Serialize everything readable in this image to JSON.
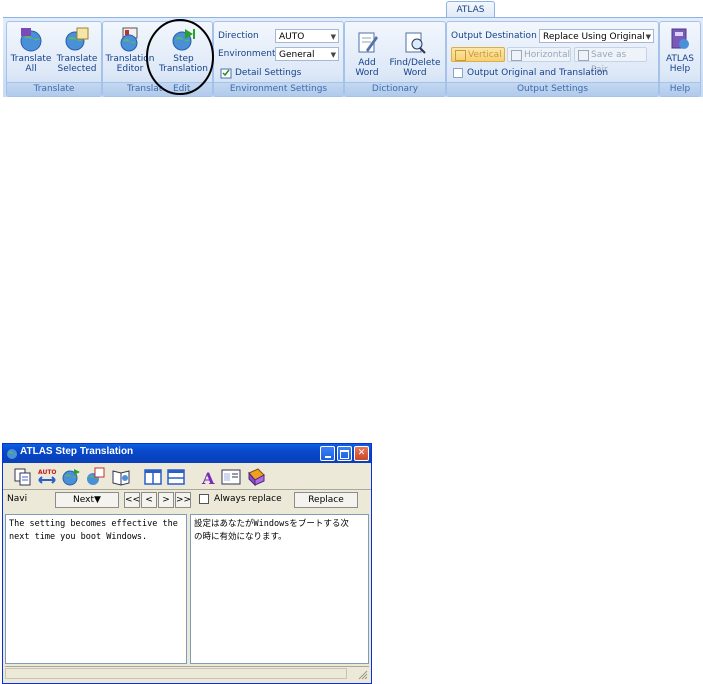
{
  "ribbon": {
    "active_tab": "ATLAS",
    "groups": {
      "translate": {
        "label": "Translate",
        "buttons": [
          {
            "line1": "Translate",
            "line2": "All"
          },
          {
            "line1": "Translate",
            "line2": "Selected"
          }
        ]
      },
      "translate_edit": {
        "label_left": "Translat",
        "label_right": "Edit",
        "buttons": [
          {
            "line1": "Translation",
            "line2": "Editor"
          },
          {
            "line1": "Step",
            "line2": "Translation"
          }
        ]
      },
      "environment": {
        "label": "Environment Settings",
        "direction_label": "Direction",
        "direction_value": "AUTO",
        "environment_label": "Environment",
        "environment_value": "General",
        "detail_settings": "Detail Settings"
      },
      "dictionary": {
        "label": "Dictionary",
        "buttons": [
          {
            "line1": "Add",
            "line2": "Word"
          },
          {
            "line1": "Find/Delete",
            "line2": "Word"
          }
        ]
      },
      "output": {
        "label": "Output Settings",
        "destination_label": "Output Destination",
        "destination_value": "Replace Using Original",
        "vertical": "Vertical",
        "horizontal": "Horizontal",
        "save_as_pair": "Save as Pair",
        "output_both": "Output Original and Translation"
      },
      "help": {
        "label": "Help",
        "button": {
          "line1": "ATLAS",
          "line2": "Help"
        }
      }
    }
  },
  "window": {
    "title": "ATLAS Step Translation",
    "navi_label": "Navi",
    "next_label": "Next▼",
    "first_label": "<<",
    "prev_label": "<",
    "forward_label": ">",
    "last_label": ">>",
    "always_replace": "Always replace",
    "replace_button": "Replace",
    "source_text_1": "The setting becomes effective the",
    "source_text_2": "next time you boot Windows.",
    "target_text_1": "設定はあなたがWindowsをブートする次",
    "target_text_2": "の時に有効になります。"
  },
  "colors": {
    "ribbon_text": "#15428b",
    "titlebar": "#0a4fd6",
    "highlight_circle": "#000000"
  }
}
